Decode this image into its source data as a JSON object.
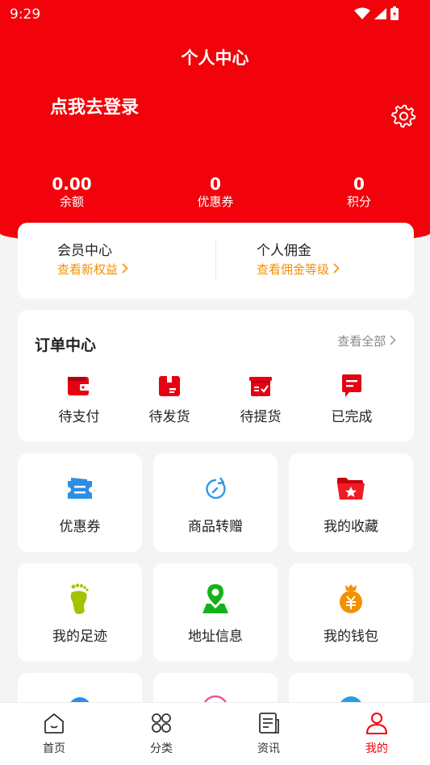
{
  "status_bar": {
    "time": "9:29"
  },
  "header": {
    "title": "个人中心",
    "login_prompt": "点我去登录"
  },
  "stats": [
    {
      "value": "0.00",
      "label": "余额"
    },
    {
      "value": "0",
      "label": "优惠券"
    },
    {
      "value": "0",
      "label": "积分"
    }
  ],
  "member": {
    "left": {
      "title": "会员中心",
      "link": "查看新权益"
    },
    "right": {
      "title": "个人佣金",
      "link": "查看佣金等级"
    }
  },
  "orders": {
    "title": "订单中心",
    "view_all": "查看全部",
    "items": [
      {
        "label": "待支付",
        "icon": "wallet-icon"
      },
      {
        "label": "待发货",
        "icon": "package-icon"
      },
      {
        "label": "待提货",
        "icon": "pickup-icon"
      },
      {
        "label": "已完成",
        "icon": "message-icon"
      }
    ]
  },
  "services": [
    {
      "label": "优惠券",
      "icon": "coupon-icon"
    },
    {
      "label": "商品转赠",
      "icon": "refresh-icon"
    },
    {
      "label": "我的收藏",
      "icon": "folder-star-icon"
    },
    {
      "label": "我的足迹",
      "icon": "footprint-icon"
    },
    {
      "label": "地址信息",
      "icon": "location-icon"
    },
    {
      "label": "我的钱包",
      "icon": "money-bag-icon"
    }
  ],
  "tabbar": [
    {
      "label": "首页",
      "icon": "home-icon"
    },
    {
      "label": "分类",
      "icon": "category-icon"
    },
    {
      "label": "资讯",
      "icon": "news-icon"
    },
    {
      "label": "我的",
      "icon": "user-icon"
    }
  ],
  "colors": {
    "primary": "#f2020a",
    "accent": "#f29100"
  }
}
